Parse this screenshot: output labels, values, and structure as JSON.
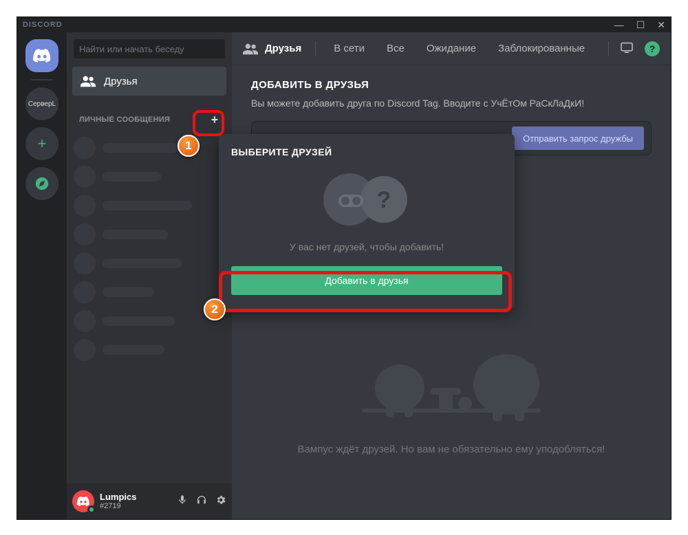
{
  "titlebar": {
    "app_name": "DISCORD"
  },
  "rail": {
    "server_label": "СерверL"
  },
  "sidebar": {
    "search_placeholder": "Найти или начать беседу",
    "friends_label": "Друзья",
    "dm_header": "ЛИЧНЫЕ СООБЩЕНИЯ"
  },
  "user": {
    "name": "Lumpics",
    "tag": "#2719"
  },
  "nav": {
    "friends": "Друзья",
    "online": "В сети",
    "all": "Все",
    "pending": "Ожидание",
    "blocked": "Заблокированные"
  },
  "add_friend": {
    "title": "ДОБАВИТЬ В ДРУЗЬЯ",
    "subtitle": "Вы можете добавить друга по Discord Tag. Вводите с УчЁтОм РаСкЛаДкИ!",
    "send_btn": "Отправить запрос дружбы"
  },
  "empty": {
    "text": "Вампус ждёт друзей. Но вам не обязательно ему уподобляться!"
  },
  "popover": {
    "title": "ВЫБЕРИТЕ ДРУЗЕЙ",
    "message": "У вас нет друзей, чтобы добавить!",
    "button": "Добавить в друзья"
  },
  "annotations": {
    "one": "1",
    "two": "2"
  }
}
